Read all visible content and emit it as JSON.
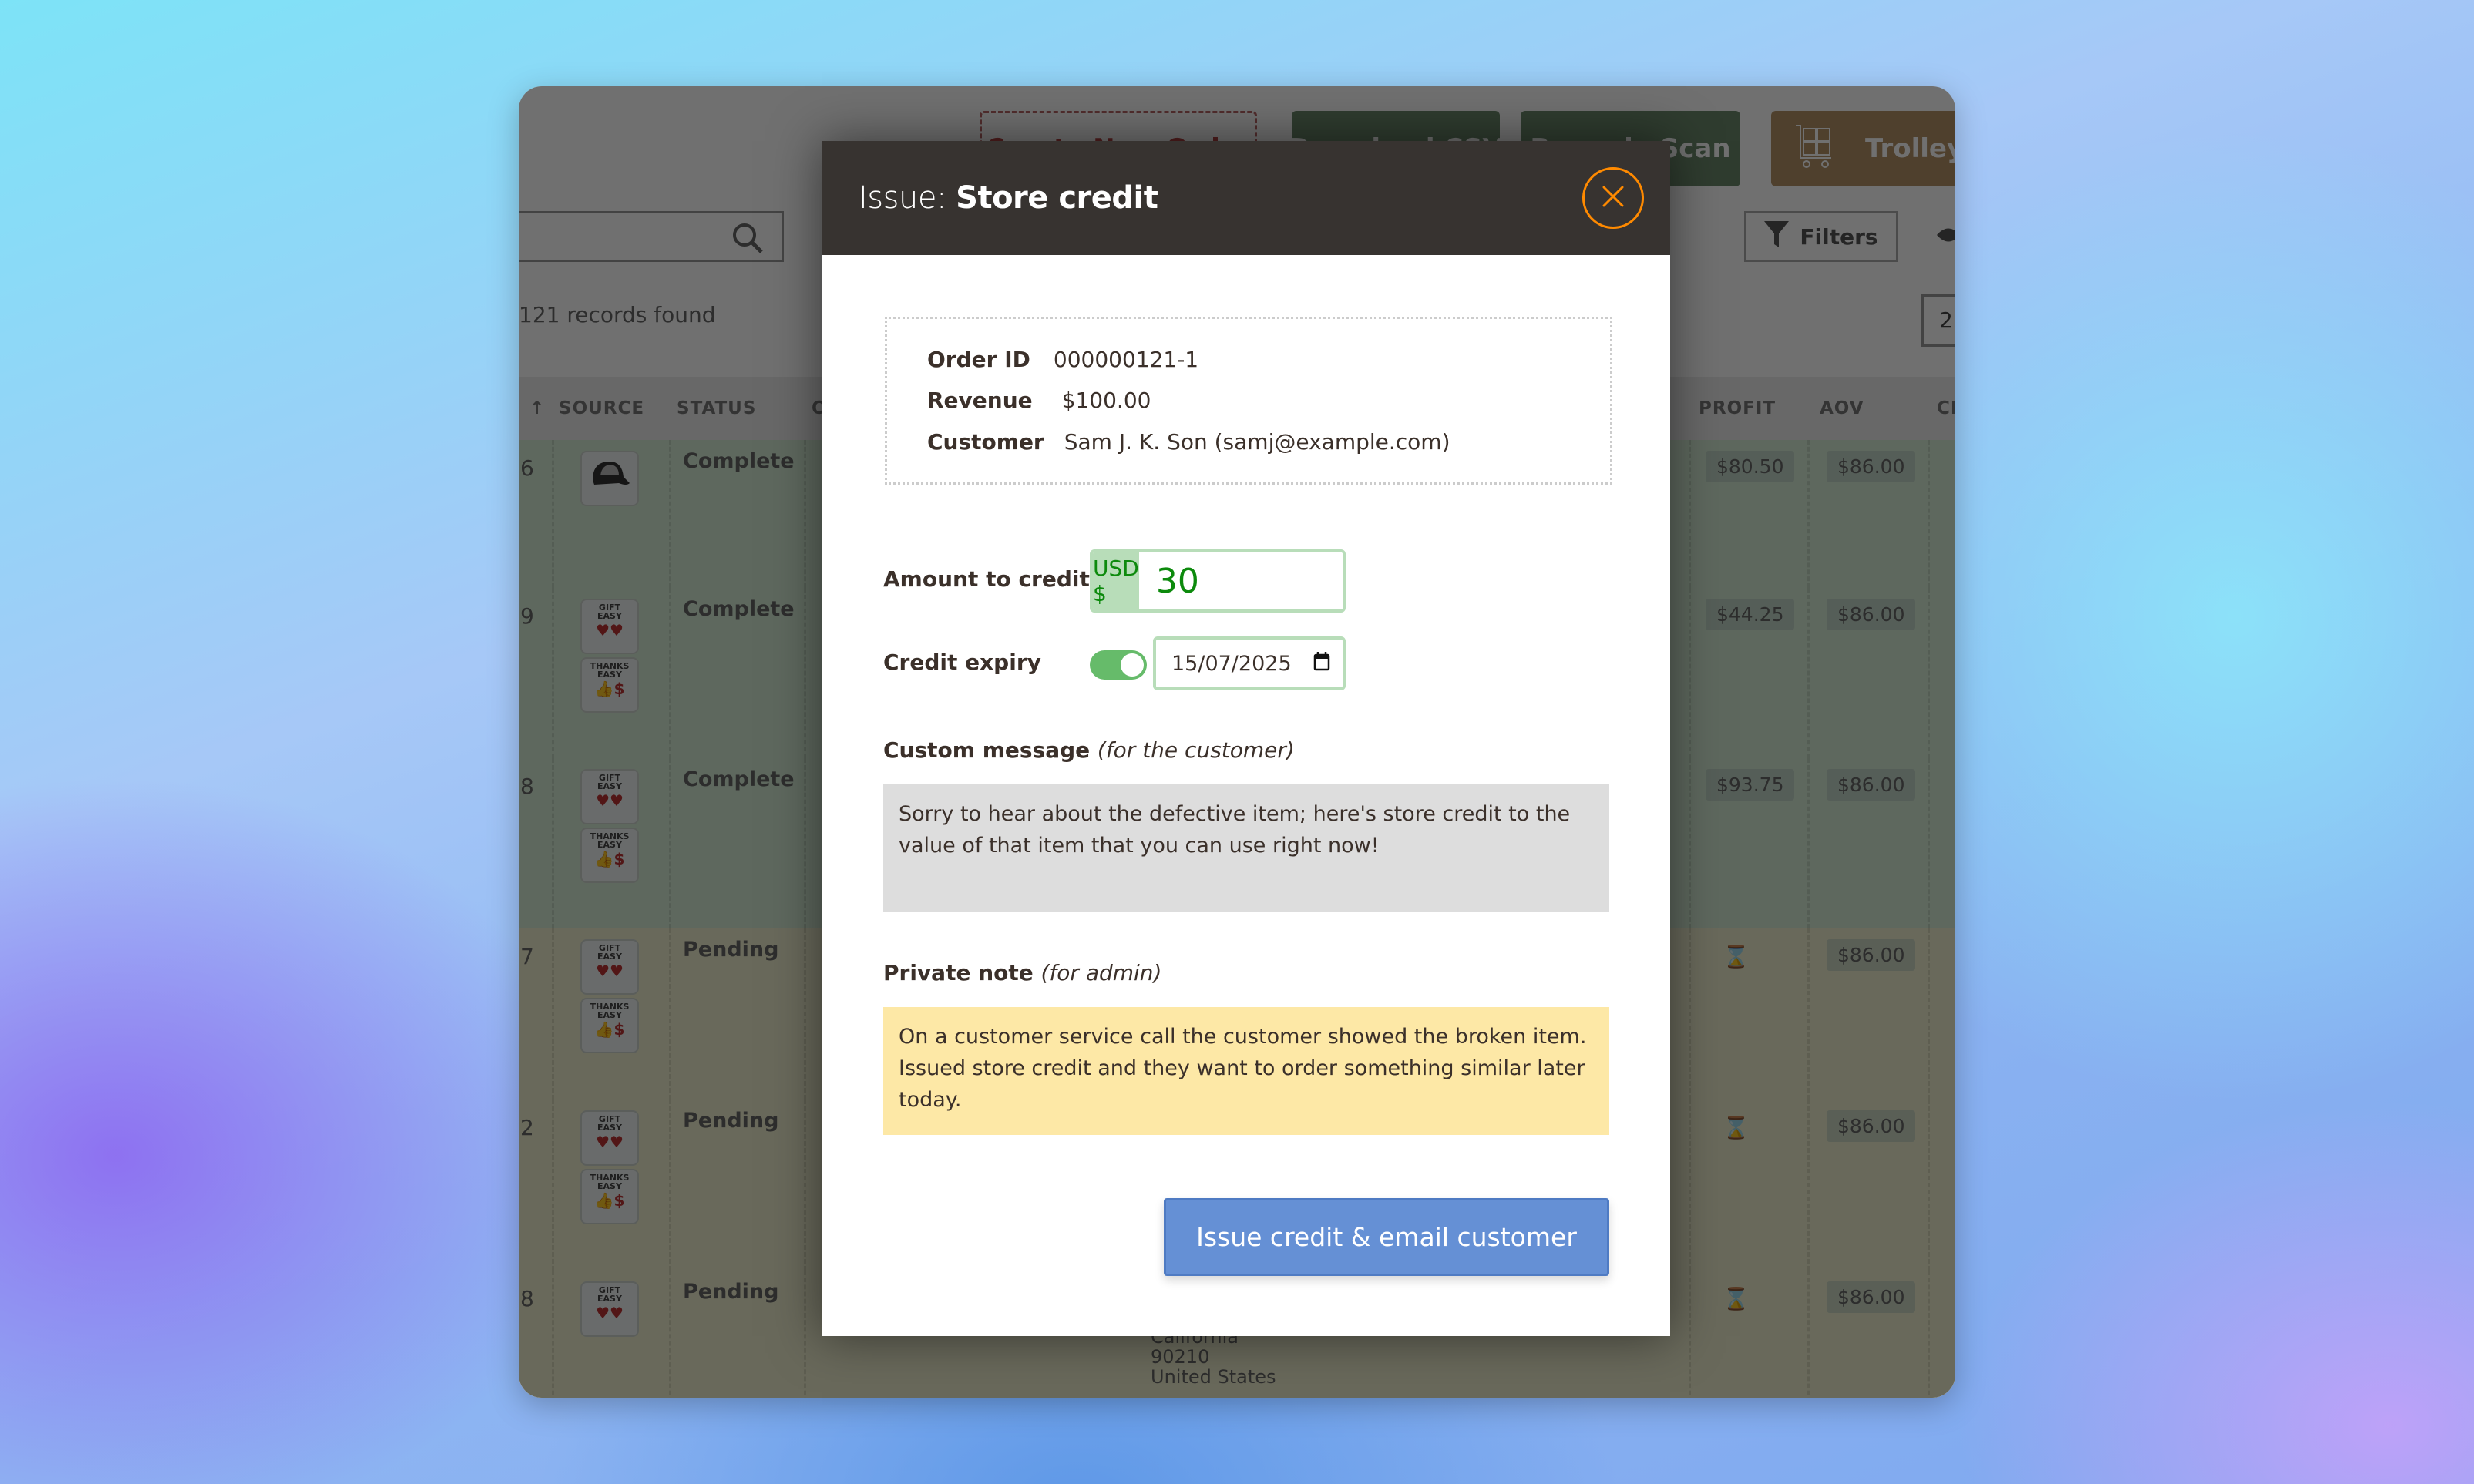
{
  "background_app": {
    "top_buttons": {
      "new_order": "Create New Order",
      "csv": "Download CSV",
      "scan": "Barcode Scan",
      "trolley": "TrolleyBox"
    },
    "search": {
      "placeholder": ""
    },
    "records_found": "121 records found",
    "filters_label": "Filters",
    "page_number": "2",
    "columns": [
      "↑",
      "SOURCE",
      "STATUS",
      "O",
      "PROFIT",
      "AOV",
      "CL"
    ],
    "rows": [
      {
        "id_fragment": "6",
        "status": "Complete",
        "sources": [
          "cap"
        ],
        "profit": "$80.50",
        "aov": "$86.00",
        "type": "complete"
      },
      {
        "id_fragment": "9",
        "status": "Complete",
        "sources": [
          "GIFT EASY",
          "THANKS EASY"
        ],
        "profit": "$44.25",
        "aov": "$86.00",
        "type": "complete"
      },
      {
        "id_fragment": "8",
        "status": "Complete",
        "sources": [
          "GIFT EASY",
          "THANKS EASY"
        ],
        "profit": "$93.75",
        "aov": "$86.00",
        "type": "complete"
      },
      {
        "id_fragment": "7",
        "status": "Pending",
        "sources": [
          "GIFT EASY",
          "THANKS EASY"
        ],
        "profit": "hourglass",
        "aov": "$86.00",
        "type": "pending"
      },
      {
        "id_fragment": "2",
        "status": "Pending",
        "sources": [
          "GIFT EASY",
          "THANKS EASY"
        ],
        "profit": "hourglass",
        "aov": "$86.00",
        "type": "pending"
      },
      {
        "id_fragment": "8",
        "status": "Pending",
        "sources": [
          "GIFT EASY"
        ],
        "profit": "hourglass",
        "aov": "$86.00",
        "type": "pending"
      }
    ],
    "address_lines": [
      "California",
      "90210",
      "United States"
    ]
  },
  "modal": {
    "title_prefix": "Issue:",
    "title_main": "Store credit",
    "close_icon": "close-circle-icon",
    "accent_color": "#ff8a00",
    "order": {
      "order_id_label": "Order ID",
      "order_id": "000000121-1",
      "revenue_label": "Revenue",
      "revenue": "$100.00",
      "customer_label": "Customer",
      "customer": "Sam J. K. Son (samj@example.com)"
    },
    "amount": {
      "label": "Amount to credit",
      "currency": "USD $",
      "value": "30"
    },
    "expiry": {
      "label": "Credit expiry",
      "enabled": true,
      "date": "15/07/2025"
    },
    "custom_message": {
      "label": "Custom message",
      "hint": "(for the customer)",
      "value": "Sorry to hear about the defective item; here's store credit to the value of that item that you can use right now!"
    },
    "private_note": {
      "label": "Private note",
      "hint": "(for admin)",
      "value": "On a customer service call the customer showed the broken item. Issued store credit and they want to order something similar later today."
    },
    "submit_label": "Issue credit & email customer"
  }
}
